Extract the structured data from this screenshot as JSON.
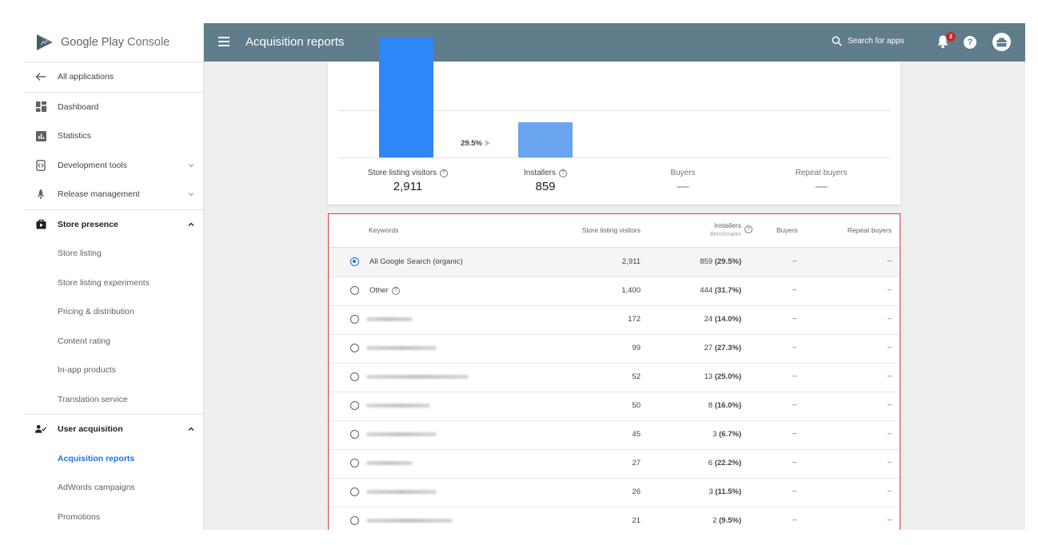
{
  "app": {
    "name_part1": "Google Play",
    "name_part2": "Console"
  },
  "header": {
    "title": "Acquisition reports",
    "search_placeholder": "Search for apps",
    "notification_count": "3",
    "help": "?"
  },
  "sidebar": {
    "back": "All applications",
    "items": [
      {
        "label": "Dashboard"
      },
      {
        "label": "Statistics"
      },
      {
        "label": "Development tools"
      },
      {
        "label": "Release management"
      }
    ],
    "store_presence": {
      "label": "Store presence",
      "items": [
        "Store listing",
        "Store listing experiments",
        "Pricing & distribution",
        "Content rating",
        "In-app products",
        "Translation service"
      ]
    },
    "user_acquisition": {
      "label": "User acquisition",
      "items": [
        "Acquisition reports",
        "AdWords campaigns",
        "Promotions"
      ]
    }
  },
  "chart_data": {
    "type": "bar",
    "categories": [
      "Store listing visitors",
      "Installers",
      "Buyers",
      "Repeat buyers"
    ],
    "values": [
      2911,
      859,
      null,
      null
    ],
    "display_values": [
      "2,911",
      "859",
      "—",
      "—"
    ],
    "annotations": [
      "29.5%"
    ],
    "grid": true
  },
  "table": {
    "headers": {
      "keywords": "Keywords",
      "visitors": "Store listing visitors",
      "installers": "Installers",
      "benchmarks": "Benchmarks",
      "buyers": "Buyers",
      "repeat": "Repeat buyers"
    },
    "rows": [
      {
        "keyword": "All Google Search (organic)",
        "visitors": "2,911",
        "installers": "859",
        "pct": "(29.5%)",
        "buyers": "–",
        "repeat": "–",
        "selected": true,
        "blur": 0
      },
      {
        "keyword": "Other",
        "visitors": "1,400",
        "installers": "444",
        "pct": "(31.7%)",
        "buyers": "–",
        "repeat": "–",
        "help": true,
        "blur": 0
      },
      {
        "keyword": "",
        "visitors": "172",
        "installers": "24",
        "pct": "(14.0%)",
        "buyers": "–",
        "repeat": "–",
        "blur": 58
      },
      {
        "keyword": "",
        "visitors": "99",
        "installers": "27",
        "pct": "(27.3%)",
        "buyers": "–",
        "repeat": "–",
        "blur": 88
      },
      {
        "keyword": "",
        "visitors": "52",
        "installers": "13",
        "pct": "(25.0%)",
        "buyers": "–",
        "repeat": "–",
        "blur": 128
      },
      {
        "keyword": "",
        "visitors": "50",
        "installers": "8",
        "pct": "(16.0%)",
        "buyers": "–",
        "repeat": "–",
        "blur": 80
      },
      {
        "keyword": "",
        "visitors": "45",
        "installers": "3",
        "pct": "(6.7%)",
        "buyers": "–",
        "repeat": "–",
        "blur": 88
      },
      {
        "keyword": "",
        "visitors": "27",
        "installers": "6",
        "pct": "(22.2%)",
        "buyers": "–",
        "repeat": "–",
        "blur": 58
      },
      {
        "keyword": "",
        "visitors": "26",
        "installers": "3",
        "pct": "(11.5%)",
        "buyers": "–",
        "repeat": "–",
        "blur": 88
      },
      {
        "keyword": "",
        "visitors": "21",
        "installers": "2",
        "pct": "(9.5%)",
        "buyers": "–",
        "repeat": "–",
        "blur": 108
      }
    ]
  },
  "colors": {
    "header": "#607d8b",
    "bar_primary": "#2e86f8",
    "bar_secondary": "#6aa3f0",
    "accent": "#1a73e8",
    "highlight_border": "#e53935"
  }
}
